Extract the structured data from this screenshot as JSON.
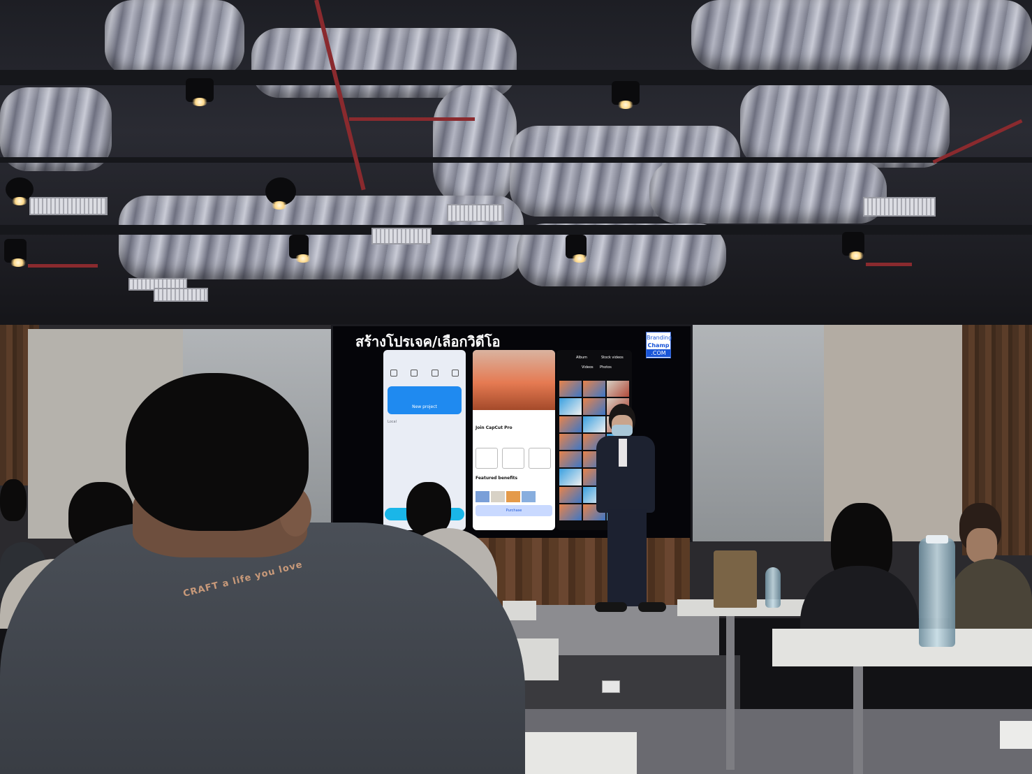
{
  "slide": {
    "title": "สร้างโปรเจค/เลือกวิดีโอ",
    "logo": {
      "line1": "Branding",
      "line2": "Champ",
      "line3": ".COM"
    }
  },
  "phones": {
    "left": {
      "new_project": "New project"
    },
    "middle": {
      "heading": "Join CapCut Pro",
      "featured": "Featured benefits",
      "purchase": "Purchase"
    },
    "right": {
      "tab_album": "Album",
      "tab_stock": "Stock videos",
      "sub_videos": "Videos",
      "sub_photos": "Photos"
    }
  },
  "audience": {
    "shirt_print": "CRAFT  a life you love"
  },
  "colors": {
    "screen_bg": "#050509",
    "accent_blue": "#1f8af0",
    "logo_blue": "#1a56d8"
  }
}
